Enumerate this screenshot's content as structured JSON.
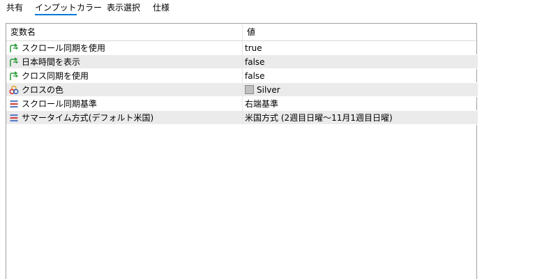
{
  "tabs": [
    {
      "label": "共有",
      "active": false
    },
    {
      "label": "インプット",
      "active": true
    },
    {
      "label": "カラー",
      "active": false
    },
    {
      "label": "表示選択",
      "active": false
    },
    {
      "label": "仕様",
      "active": false
    }
  ],
  "grid": {
    "header": {
      "name": "変数名",
      "value": "値"
    },
    "rows": [
      {
        "icon": "bool-arrow-icon",
        "name": "スクロール同期を使用",
        "value": "true"
      },
      {
        "icon": "bool-arrow-icon",
        "name": "日本時間を表示",
        "value": "false"
      },
      {
        "icon": "bool-arrow-icon",
        "name": "クロス同期を使用",
        "value": "false"
      },
      {
        "icon": "color-circles-icon",
        "name": "クロスの色",
        "value": "Silver",
        "swatch": "#c0c0c0"
      },
      {
        "icon": "enum-list-icon",
        "name": "スクロール同期基準",
        "value": "右端基準"
      },
      {
        "icon": "enum-list-icon",
        "name": "サマータイム方式(デフォルト米国)",
        "value": "米国方式 (2週目日曜～11月1週目日曜)"
      }
    ]
  },
  "colors": {
    "accent": "#0078d7",
    "row_alt": "#ebebeb",
    "bool_icon": "#2e9e3e"
  }
}
